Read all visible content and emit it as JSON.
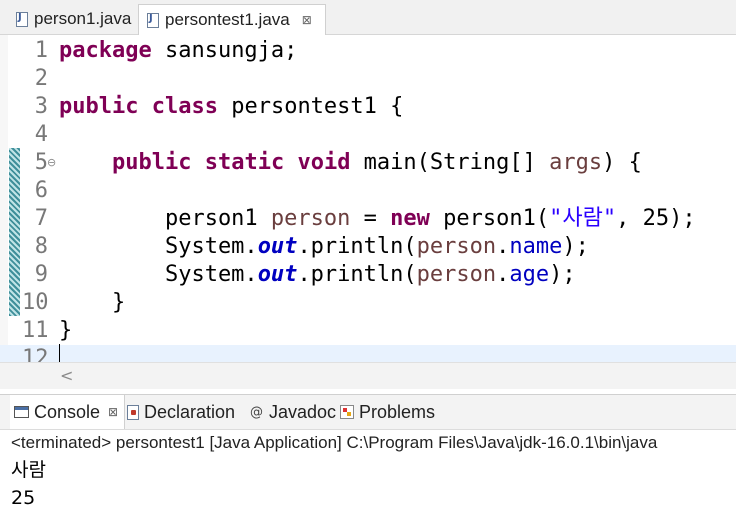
{
  "editor_tabs": [
    {
      "label": "person1.java",
      "active": false
    },
    {
      "label": "persontest1.java",
      "active": true,
      "close": "⊠"
    }
  ],
  "code_lines": [
    {
      "n": "1",
      "tokens": [
        {
          "t": "package",
          "c": "kw"
        },
        {
          "t": " sansungja;"
        }
      ]
    },
    {
      "n": "2",
      "tokens": []
    },
    {
      "n": "3",
      "tokens": [
        {
          "t": "public",
          "c": "kw"
        },
        {
          "t": " "
        },
        {
          "t": "class",
          "c": "kw"
        },
        {
          "t": " persontest1 {"
        }
      ]
    },
    {
      "n": "4",
      "tokens": []
    },
    {
      "n": "5",
      "fold": "⊖",
      "tokens": [
        {
          "t": "    "
        },
        {
          "t": "public",
          "c": "kw"
        },
        {
          "t": " "
        },
        {
          "t": "static",
          "c": "kw"
        },
        {
          "t": " "
        },
        {
          "t": "void",
          "c": "kw"
        },
        {
          "t": " main(String[] "
        },
        {
          "t": "args",
          "c": "local"
        },
        {
          "t": ") {"
        }
      ]
    },
    {
      "n": "6",
      "tokens": []
    },
    {
      "n": "7",
      "tokens": [
        {
          "t": "        person1 "
        },
        {
          "t": "person",
          "c": "local"
        },
        {
          "t": " = "
        },
        {
          "t": "new",
          "c": "kw"
        },
        {
          "t": " person1("
        },
        {
          "t": "\"사람\"",
          "c": "str"
        },
        {
          "t": ", 25);"
        }
      ]
    },
    {
      "n": "8",
      "tokens": [
        {
          "t": "        System."
        },
        {
          "t": "out",
          "c": "field-static"
        },
        {
          "t": ".println("
        },
        {
          "t": "person",
          "c": "local"
        },
        {
          "t": "."
        },
        {
          "t": "name",
          "c": "field"
        },
        {
          "t": ");"
        }
      ]
    },
    {
      "n": "9",
      "tokens": [
        {
          "t": "        System."
        },
        {
          "t": "out",
          "c": "field-static"
        },
        {
          "t": ".println("
        },
        {
          "t": "person",
          "c": "local"
        },
        {
          "t": "."
        },
        {
          "t": "age",
          "c": "field"
        },
        {
          "t": ");"
        }
      ]
    },
    {
      "n": "10",
      "tokens": [
        {
          "t": "    }"
        }
      ]
    },
    {
      "n": "11",
      "tokens": [
        {
          "t": "}"
        }
      ]
    },
    {
      "n": "12",
      "tokens": [],
      "current": true
    }
  ],
  "scroll": {
    "left_arrow": "<"
  },
  "view_tabs": [
    {
      "label": "Console",
      "active": true,
      "icon": "console-icon",
      "close": "⊠"
    },
    {
      "label": "Declaration",
      "active": false,
      "icon": "declaration-icon"
    },
    {
      "label": "Javadoc",
      "active": false,
      "icon": "javadoc-icon",
      "glyph": "@"
    },
    {
      "label": "Problems",
      "active": false,
      "icon": "problems-icon"
    }
  ],
  "console": {
    "header": "<terminated> persontest1 [Java Application] C:\\Program Files\\Java\\jdk-16.0.1\\bin\\java",
    "output": [
      "사람",
      "25"
    ]
  }
}
